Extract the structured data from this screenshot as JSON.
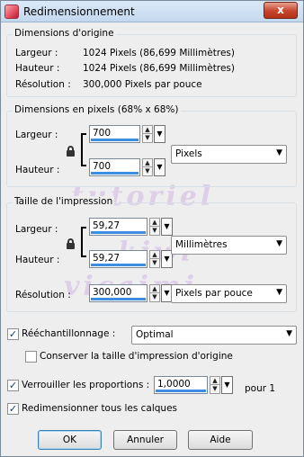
{
  "window": {
    "title": "Redimensionnement",
    "close_label": "x"
  },
  "original": {
    "legend": "Dimensions d'origine",
    "width_label": "Largeur :",
    "width_value": "1024 Pixels (86,699 Millimètres)",
    "height_label": "Hauteur :",
    "height_value": "1024 Pixels (86,699 Millimètres)",
    "res_label": "Résolution :",
    "res_value": "300,000 Pixels par pouce"
  },
  "pixels": {
    "legend": "Dimensions en pixels (68% x 68%)",
    "width_label": "Largeur :",
    "width_value": "700",
    "height_label": "Hauteur :",
    "height_value": "700",
    "unit": "Pixels"
  },
  "print": {
    "legend": "Taille de l'impression",
    "width_label": "Largeur :",
    "width_value": "59,27",
    "height_label": "Hauteur :",
    "height_value": "59,27",
    "unit": "Millimètres",
    "res_label": "Résolution :",
    "res_value": "300,000",
    "res_unit": "Pixels par pouce"
  },
  "options": {
    "resample_label": "Rééchantillonnage :",
    "resample_checked": true,
    "resample_method": "Optimal",
    "keep_print_label": "Conserver la taille d'impression d'origine",
    "keep_print_checked": false,
    "lock_ratio_label": "Verrouiller les proportions :",
    "lock_ratio_checked": true,
    "lock_ratio_value": "1,0000",
    "lock_ratio_suffix": "pour 1",
    "all_layers_label": "Redimensionner tous les calques",
    "all_layers_checked": true,
    "check_mark": "✓"
  },
  "buttons": {
    "ok": "OK",
    "cancel": "Annuler",
    "help": "Aide"
  },
  "watermark": {
    "line1": "tutoriel",
    "line2": "kiwi",
    "line3": "vicaimi"
  }
}
